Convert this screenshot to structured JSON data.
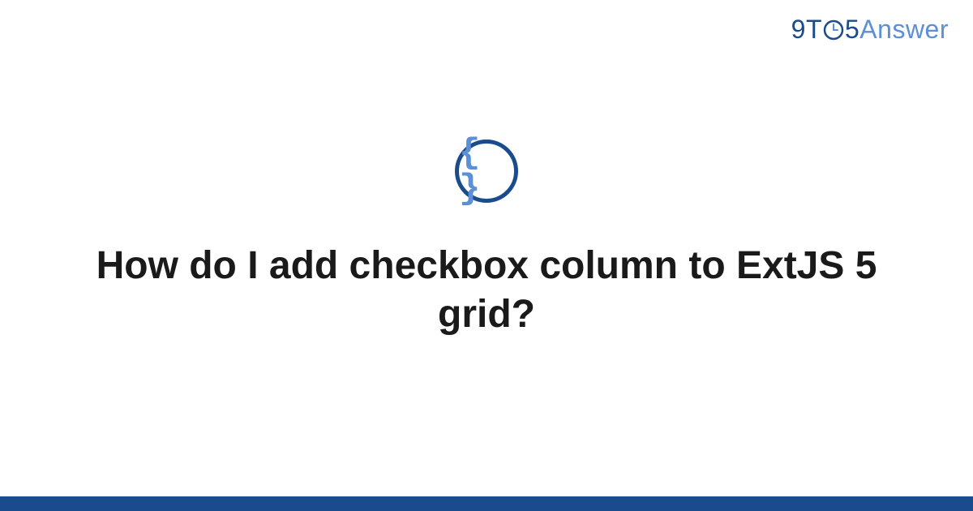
{
  "logo": {
    "part1": "9T",
    "part2": "5",
    "part3": "Answer"
  },
  "category_icon": {
    "glyph": "{ }",
    "name": "code-braces"
  },
  "question": {
    "title": "How do I add checkbox column to ExtJS 5 grid?"
  },
  "colors": {
    "primary": "#1a4b8c",
    "accent": "#5b8fd6"
  }
}
